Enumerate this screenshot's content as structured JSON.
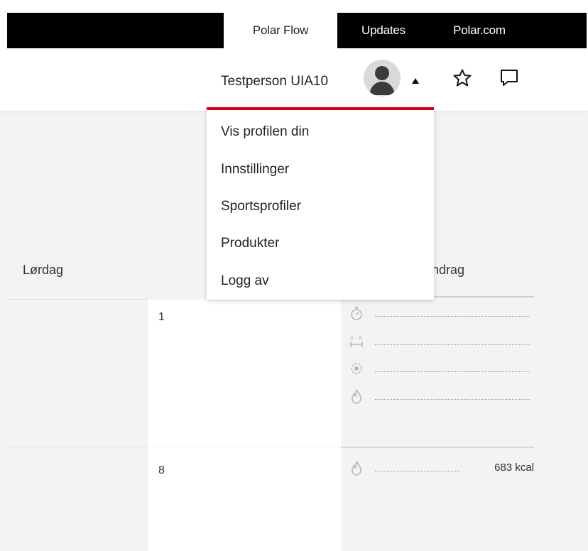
{
  "nav": {
    "tabs": [
      {
        "label": "Polar Flow"
      },
      {
        "label": "Updates"
      },
      {
        "label": "Polar.com"
      }
    ]
  },
  "header": {
    "user_name": "Testperson UIA10",
    "icons": [
      "avatar",
      "caret-up-icon",
      "star-icon",
      "chat-icon"
    ]
  },
  "profile_menu": {
    "items": [
      {
        "label": "Vis profilen din"
      },
      {
        "label": "Innstillinger"
      },
      {
        "label": "Sportsprofiler"
      },
      {
        "label": "Produkter"
      },
      {
        "label": "Logg av"
      }
    ]
  },
  "calendar": {
    "day_header": "Lørdag",
    "summary_header_visible": "endrag",
    "rows": [
      {
        "date": "1",
        "summary": [
          {
            "icon": "stopwatch-icon",
            "value": ""
          },
          {
            "icon": "distance-icon",
            "value": ""
          },
          {
            "icon": "pulse-icon",
            "value": ""
          },
          {
            "icon": "flame-icon",
            "value": ""
          }
        ]
      },
      {
        "date": "8",
        "summary": [
          {
            "icon": "flame-icon",
            "value": "683 kcal"
          }
        ]
      }
    ]
  },
  "colors": {
    "accent": "#d0021b",
    "topbar": "#000000",
    "background": "#f3f3f3"
  }
}
